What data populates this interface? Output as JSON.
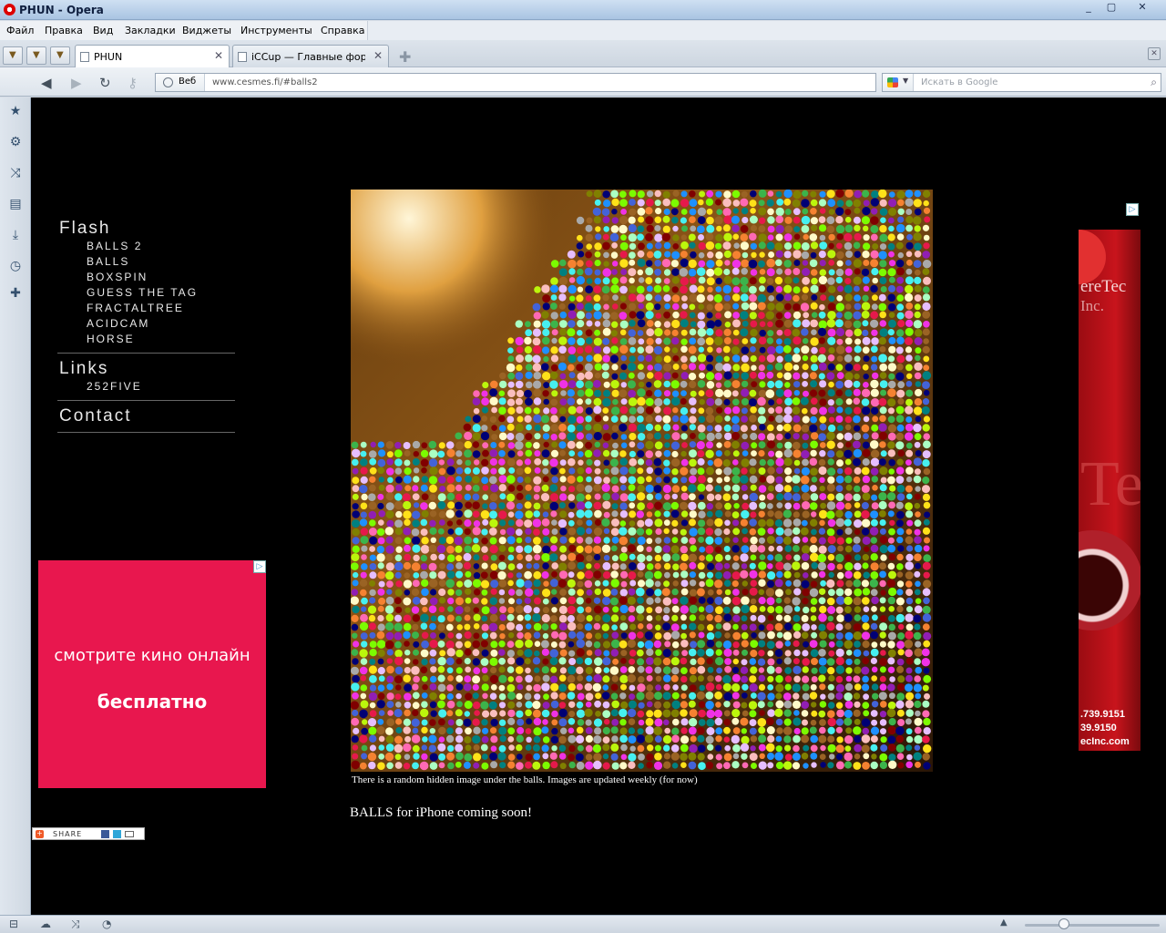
{
  "window": {
    "title": "PHUN - Opera",
    "controls": [
      "_",
      "▢",
      "✕"
    ]
  },
  "menu": [
    "Файл",
    "Правка",
    "Вид",
    "Закладки",
    "Виджеты",
    "Инструменты",
    "Справка"
  ],
  "tabs": [
    {
      "label": "PHUN",
      "active": true
    },
    {
      "label": "iCCup — Главные фору...",
      "active": false
    }
  ],
  "address": {
    "veb_label": "Веб",
    "url": "www.cesmes.fi/#balls2",
    "search_placeholder": "Искать в Google"
  },
  "nav": {
    "flash_heading": "Flash",
    "flash_items": [
      "BALLS 2",
      "BALLS",
      "BOXSPIN",
      "GUESS THE TAG",
      "FRACTALTREE",
      "ACIDCAM",
      "HORSE"
    ],
    "links_heading": "Links",
    "links_items": [
      "252FIVE"
    ],
    "contact_heading": "Contact"
  },
  "left_ad": {
    "line1": "смотрите кино онлайн",
    "line2": "бесплатно"
  },
  "share": {
    "label": "SHARE"
  },
  "main": {
    "caption": "There is a random hidden image under the balls. Images are updated weekly (for now)",
    "iphone_note": "BALLS for iPhone coming soon!"
  },
  "right_ad": {
    "brand": "ereTec",
    "brand2": "Inc.",
    "phone1": ".739.9151",
    "phone2": "39.9150",
    "site": "ecInc.com"
  },
  "colors": {
    "accent_ad": "#e8174e",
    "page_bg": "#000000",
    "ball_palette": [
      "#e6194b",
      "#3cb44b",
      "#ffe119",
      "#4363d8",
      "#f58231",
      "#911eb4",
      "#46f0f0",
      "#f032e6",
      "#bcf60c",
      "#fabebe",
      "#008080",
      "#e6beff",
      "#9a6324",
      "#fffac8",
      "#800000",
      "#aaffc3",
      "#808000",
      "#000075",
      "#a9a9a9",
      "#1e90ff",
      "#7cfc00",
      "#ff69b4"
    ]
  }
}
